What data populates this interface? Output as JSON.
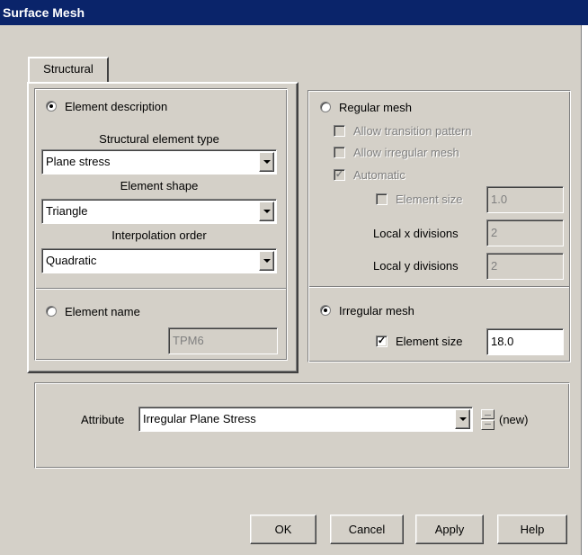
{
  "window": {
    "title": "Surface Mesh"
  },
  "tabs": [
    {
      "label": "Structural"
    }
  ],
  "element": {
    "description_label": "Element description",
    "type_label": "Structural element type",
    "type_value": "Plane stress",
    "shape_label": "Element shape",
    "shape_value": "Triangle",
    "order_label": "Interpolation order",
    "order_value": "Quadratic",
    "name_label": "Element name",
    "name_value": "TPM6",
    "selected": "description"
  },
  "regular_mesh": {
    "label": "Regular mesh",
    "allow_transition_label": "Allow transition pattern",
    "allow_irregular_label": "Allow irregular mesh",
    "automatic_label": "Automatic",
    "automatic_checked": true,
    "element_size_label": "Element size",
    "element_size_value": "1.0",
    "local_x_label": "Local x divisions",
    "local_x_value": "2",
    "local_y_label": "Local y divisions",
    "local_y_value": "2"
  },
  "irregular_mesh": {
    "label": "Irregular mesh",
    "selected": true,
    "element_size_label": "Element size",
    "element_size_checked": true,
    "element_size_value": "18.0"
  },
  "attribute": {
    "label": "Attribute",
    "value": "Irregular Plane Stress",
    "new_label": "(new)"
  },
  "buttons": {
    "ok": "OK",
    "cancel": "Cancel",
    "apply": "Apply",
    "help": "Help"
  },
  "glyphs": {
    "check": "✓"
  }
}
